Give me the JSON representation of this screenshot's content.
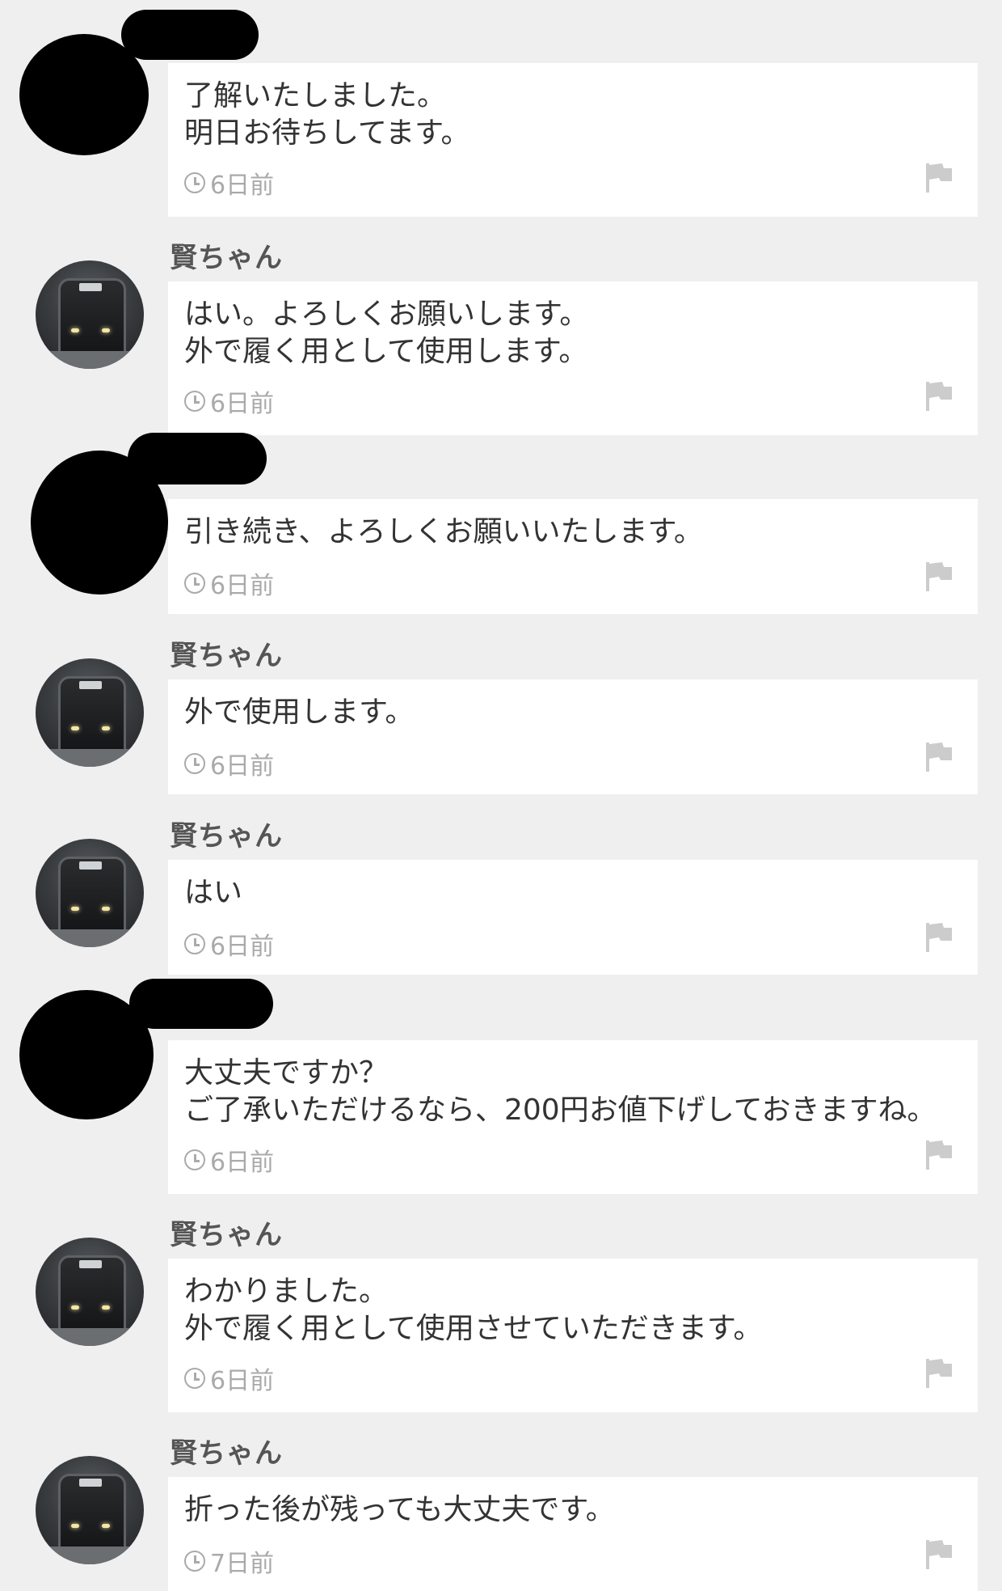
{
  "messages": [
    {
      "sender": "",
      "text": "了解いたしました。\n明日お待ちしてます。",
      "time": "6日前"
    },
    {
      "sender": "賢ちゃん",
      "text": "はい。よろしくお願いします。\n外で履く用として使用します。",
      "time": "6日前"
    },
    {
      "sender": "",
      "text": "引き続き、よろしくお願いいたします。",
      "time": "6日前"
    },
    {
      "sender": "賢ちゃん",
      "text": "外で使用します。",
      "time": "6日前"
    },
    {
      "sender": "賢ちゃん",
      "text": "はい",
      "time": "6日前"
    },
    {
      "sender": "",
      "text": "大丈夫ですか？\nご了承いただけるなら、200円お値下げしておきますね。",
      "time": "6日前"
    },
    {
      "sender": "賢ちゃん",
      "text": "わかりました。\n外で履く用として使用させていただきます。",
      "time": "6日前"
    },
    {
      "sender": "賢ちゃん",
      "text": "折った後が残っても大丈夫です。",
      "time": "7日前"
    }
  ]
}
